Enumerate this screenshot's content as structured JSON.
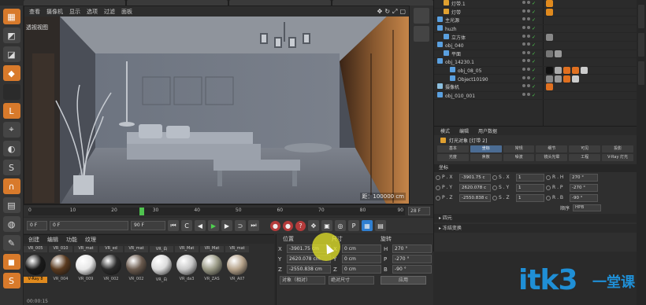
{
  "tabstrip": [
    "",
    "",
    "",
    ""
  ],
  "viewport": {
    "menus": [
      "查看",
      "摄像机",
      "显示",
      "选项",
      "过滤",
      "面板"
    ],
    "label": "透视视图",
    "scale": "距：100000 cm"
  },
  "timeline": {
    "ticks": [
      "0",
      "10",
      "20",
      "30",
      "40",
      "50",
      "60",
      "70",
      "80",
      "90"
    ],
    "current_frame": 27,
    "end_field": "28 F"
  },
  "transport": {
    "start_field": "0 F",
    "cur_field": "0 F",
    "end_field": "90 F"
  },
  "material_manager": {
    "menus": [
      "创建",
      "编辑",
      "功能",
      "纹理"
    ],
    "materials": [
      {
        "top": "VR_005",
        "bottom": "V-Ray 8",
        "color": "#1a1a1a",
        "selected": true
      },
      {
        "top": "VR_010",
        "bottom": "VR_004",
        "color": "#5a3a1f",
        "selected": false
      },
      {
        "top": "VR_mat",
        "bottom": "VR_009",
        "color": "#e8e8e8",
        "selected": false
      },
      {
        "top": "VR_ed",
        "bottom": "VR_002",
        "color": "#2a2a2a",
        "selected": false
      },
      {
        "top": "VR_mat",
        "bottom": "VR_002",
        "color": "#6a5a4e",
        "selected": false
      },
      {
        "top": "VR_白",
        "bottom": "VR_白",
        "color": "#dcdcdc",
        "selected": false
      },
      {
        "top": "VR_Mat",
        "bottom": "VR_da3",
        "color": "#c8c8c8",
        "selected": false
      },
      {
        "top": "VR_Mat",
        "bottom": "VR_ZAS",
        "color": "#9a9a86",
        "selected": false
      },
      {
        "top": "VR_mat",
        "bottom": "VR_All7",
        "color": "#b5a28a",
        "selected": false
      }
    ],
    "time": "00:00:15"
  },
  "coordinates": {
    "headers": [
      "位置",
      "尺寸",
      "旋转"
    ],
    "rows": [
      {
        "axis": "X",
        "pos": "-3901.75 cm",
        "size": "0 cm",
        "rot_axis": "H",
        "rot": "270 °"
      },
      {
        "axis": "Y",
        "pos": "2620.078 cm",
        "size": "0 cm",
        "rot_axis": "P",
        "rot": "-270 °"
      },
      {
        "axis": "Z",
        "pos": "-2550.838 cm",
        "size": "0 cm",
        "rot_axis": "B",
        "rot": "-90 °"
      }
    ],
    "mode1": "对象（相对）",
    "mode2": "绝对尺寸",
    "apply": "应用"
  },
  "object_manager": {
    "rows": [
      {
        "name": "灯带.1",
        "indent": 1,
        "icon": "#e0a030",
        "tags": [
          "#e08a1e"
        ]
      },
      {
        "name": "灯带",
        "indent": 1,
        "icon": "#e0a030",
        "tags": [
          "#e08a1e"
        ]
      },
      {
        "name": "主光源",
        "indent": 0,
        "icon": "#5aa0e0",
        "tags": []
      },
      {
        "name": "huzh",
        "indent": 0,
        "icon": "#5aa0e0",
        "tags": []
      },
      {
        "name": "立方体",
        "indent": 1,
        "icon": "#5aa0e0",
        "tags": [
          "#888"
        ]
      },
      {
        "name": "obj_040",
        "indent": 0,
        "icon": "#5aa0e0",
        "tags": []
      },
      {
        "name": "平面",
        "indent": 1,
        "icon": "#5aa0e0",
        "tags": [
          "#777",
          "#999"
        ]
      },
      {
        "name": "obj_14230.1",
        "indent": 0,
        "icon": "#5aa0e0",
        "tags": []
      },
      {
        "name": "obj_08_05",
        "indent": 2,
        "icon": "#5aa0e0",
        "tags": [
          "#111",
          "#aaa",
          "#e07020",
          "#e07020",
          "#ccc"
        ]
      },
      {
        "name": "Object10190",
        "indent": 2,
        "icon": "#5aa0e0",
        "tags": [
          "#888",
          "#999",
          "#e07020",
          "#ccc"
        ]
      },
      {
        "name": "摄像机",
        "indent": 0,
        "icon": "#8cc0e0",
        "tags": [
          "#e07020"
        ]
      },
      {
        "name": "obj_010_001",
        "indent": 0,
        "icon": "#5aa0e0",
        "tags": []
      }
    ]
  },
  "attribute_manager": {
    "menus": [
      "模式",
      "编辑",
      "用户数据"
    ],
    "title": "灯光对象 [灯带 2]",
    "tabs": [
      "基本",
      "坐标",
      "常规",
      "细节",
      "可见",
      "投影",
      "光度",
      "焦散",
      "噪波",
      "镜头光晕",
      "工程",
      "V-Ray 灯光"
    ],
    "active_tab": 1,
    "section": "坐标",
    "rows": [
      {
        "p": "P . X",
        "pv": "-3901.75 c",
        "s": "S . X",
        "sv": "1",
        "r": "R . H",
        "rv": "270 °"
      },
      {
        "p": "P . Y",
        "pv": "2620.078 c",
        "s": "S . Y",
        "sv": "1",
        "r": "R . P",
        "rv": "-270 °"
      },
      {
        "p": "P . Z",
        "pv": "-2550.838 c",
        "s": "S . Z",
        "sv": "1",
        "r": "R . B",
        "rv": "-90 °"
      }
    ],
    "order_label": "顺序",
    "order_value": "HPB",
    "collapsed": [
      "四元",
      "冻结变换"
    ]
  },
  "watermark": {
    "latin": "itk3",
    "cn": "一堂课"
  }
}
